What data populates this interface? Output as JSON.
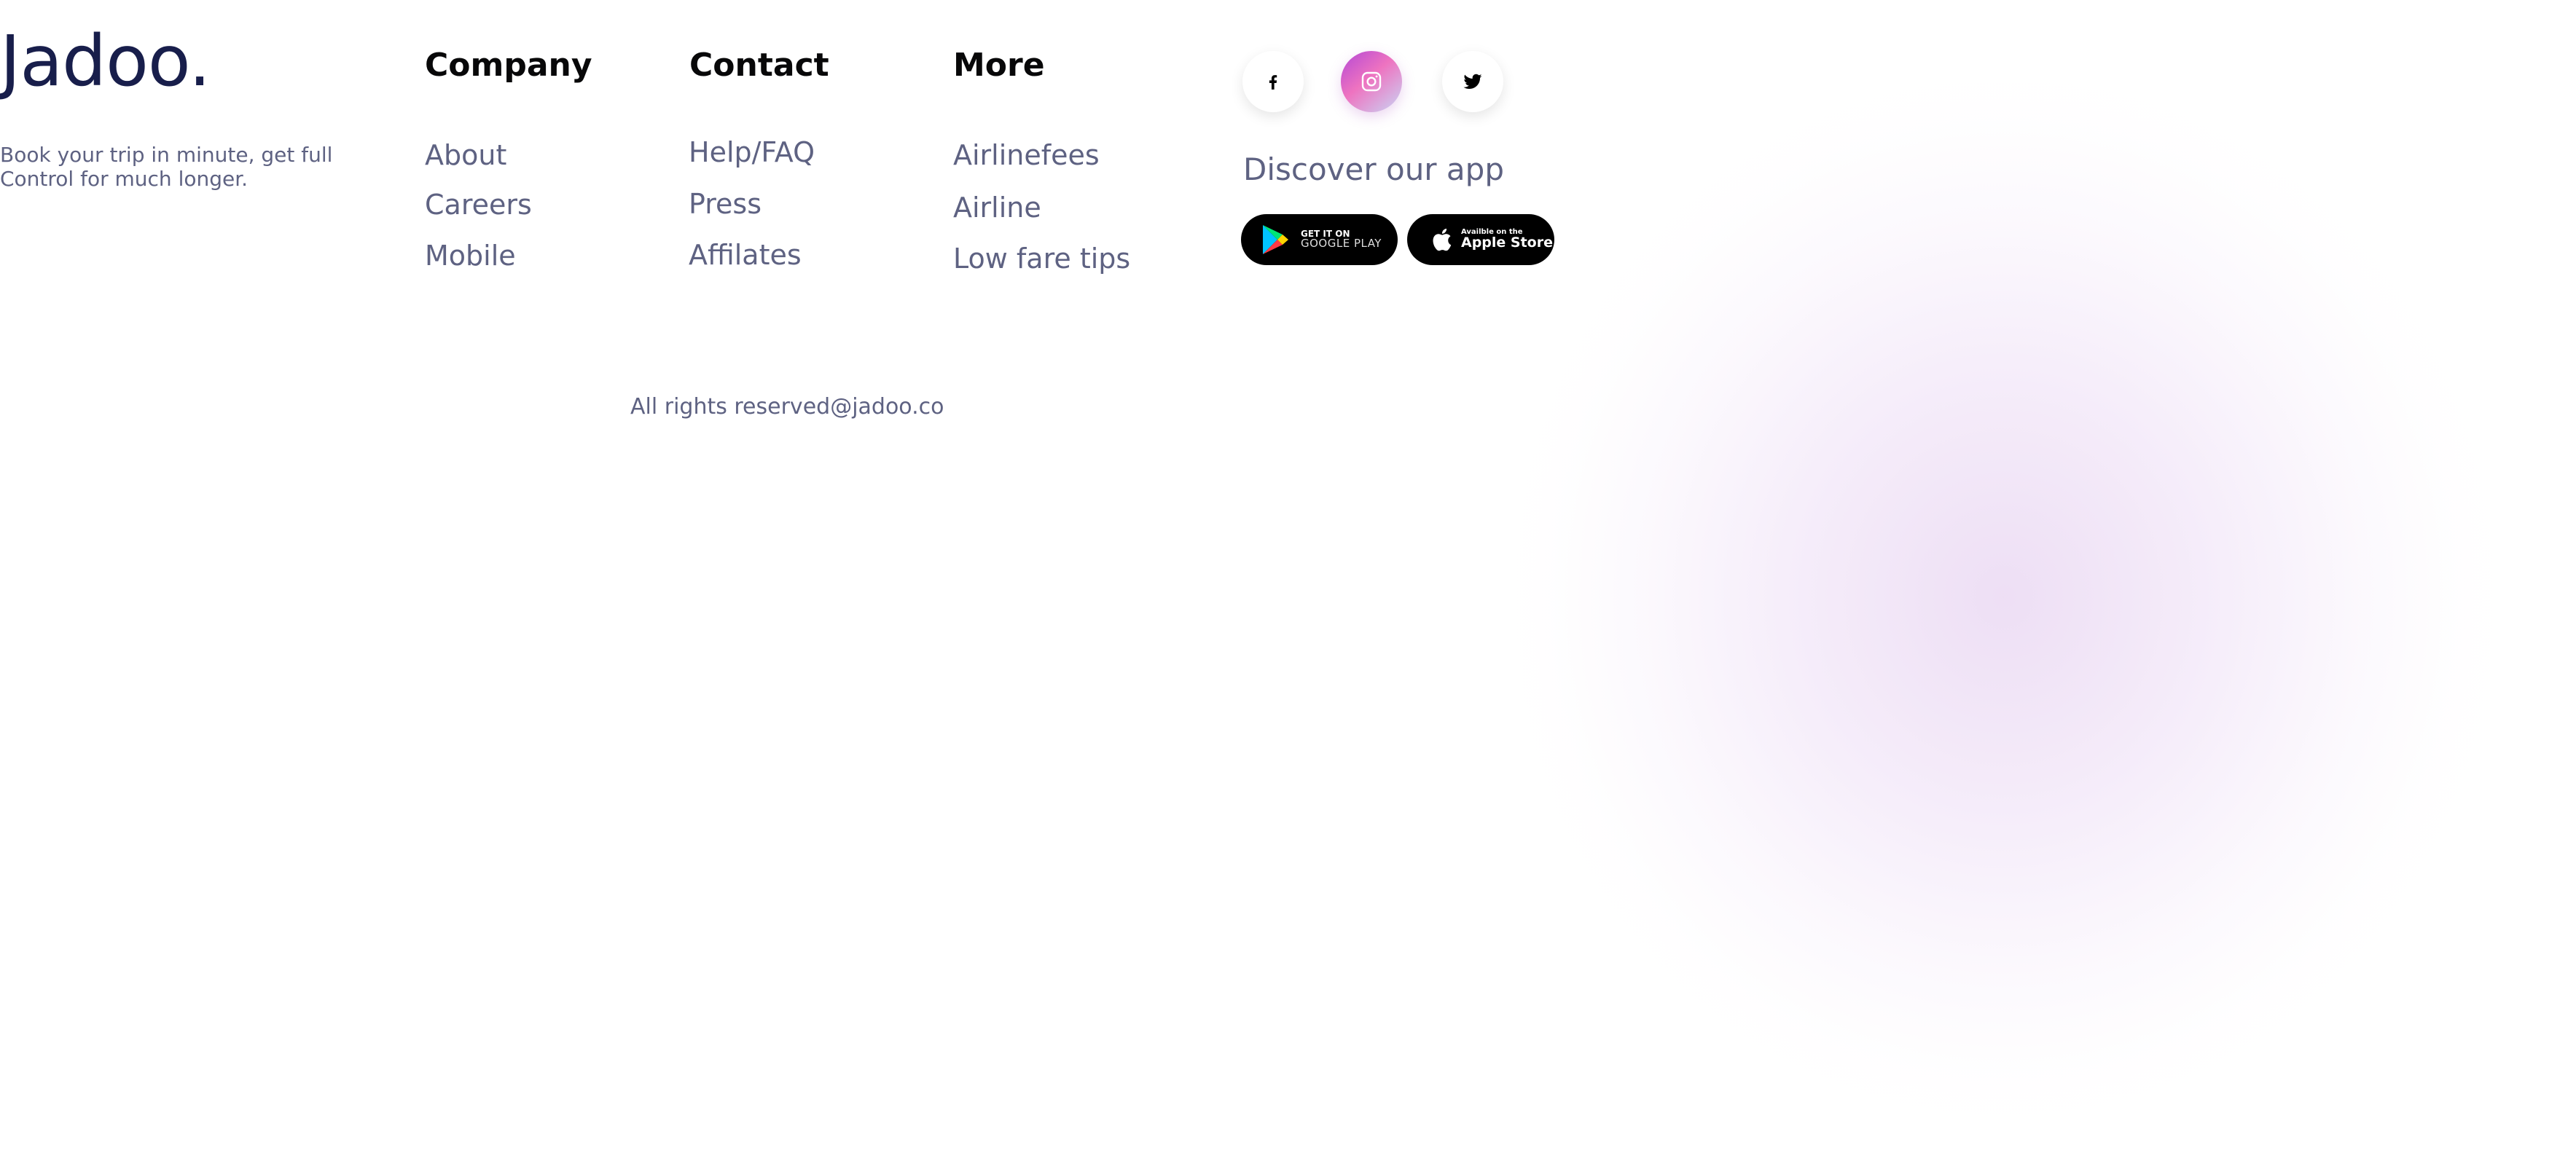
{
  "brand": {
    "logo": "Jadoo.",
    "tagline": "Book your trip in minute, get full Control for much longer."
  },
  "columns": [
    {
      "heading": "Company",
      "links": [
        "About",
        "Careers",
        "Mobile"
      ]
    },
    {
      "heading": "Contact",
      "links": [
        "Help/FAQ",
        "Press",
        "Affilates"
      ]
    },
    {
      "heading": "More",
      "links": [
        "Airlinefees",
        "Airline",
        "Low fare tips"
      ]
    }
  ],
  "social": {
    "facebook_icon": "facebook-icon",
    "instagram_icon": "instagram-icon",
    "twitter_icon": "twitter-icon"
  },
  "app": {
    "discover": "Discover our app",
    "google_play_top": "GET IT ON",
    "google_play_bottom": "GOOGLE PLAY",
    "apple_top": "Availble on the",
    "apple_bottom": "Apple Store"
  },
  "footer": {
    "copyright": "All rights reserved@jadoo.co"
  },
  "colors": {
    "heading": "#080809",
    "text": "#5e6282",
    "logo": "#181e4b",
    "blob": "#dfc4ec"
  }
}
